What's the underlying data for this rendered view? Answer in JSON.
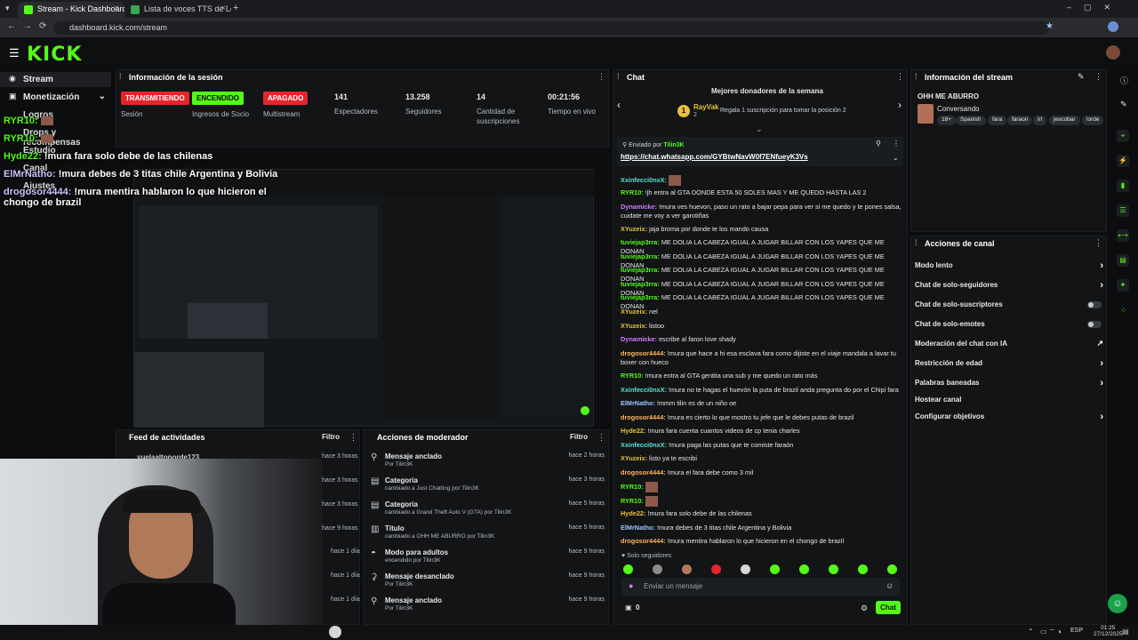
{
  "browser": {
    "tabs": [
      {
        "title": "Stream - Kick Dashboard"
      },
      {
        "title": "Lista de voces TTS de LordEmp"
      }
    ],
    "url": "dashboard.kick.com/stream"
  },
  "brand": {
    "logo": "KICK",
    "accent": "#53fc18"
  },
  "sidebar": {
    "items": [
      {
        "label": "Stream"
      },
      {
        "label": "Monetización"
      },
      {
        "label": "Logros"
      },
      {
        "label": "Drops y recompensas"
      },
      {
        "label": "Estudio"
      },
      {
        "label": "Canal"
      },
      {
        "label": "Ajustes"
      }
    ]
  },
  "overlay_chat": [
    {
      "user": "RYR10:",
      "text": ""
    },
    {
      "user": "RYR10:",
      "text": ""
    },
    {
      "user": "Hyde22:",
      "text": "!mura fara solo debe de las chilenas"
    },
    {
      "user": "ElMrNatho:",
      "text": "!mura debes de 3 titas chile Argentina y Bolivia"
    },
    {
      "user": "drogosor4444:",
      "text": "!mura mentira hablaron lo que hicieron el chongo de brazil"
    }
  ],
  "session": {
    "title": "Información de la sesión",
    "stats": [
      {
        "value": "TRANSMITIENDO",
        "label": "Sesión",
        "color": "#e5252b"
      },
      {
        "value": "ENCENDIDO",
        "label": "Ingresos de Socio",
        "color": "#53fc18"
      },
      {
        "value": "APAGADO",
        "label": "Multistream",
        "color": "#e5252b"
      },
      {
        "value": "141",
        "label": "Espectadores"
      },
      {
        "value": "13.258",
        "label": "Seguidores"
      },
      {
        "value": "14",
        "label": "Cantidad de suscripciones"
      },
      {
        "value": "00:21:56",
        "label": "Tiempo en vivo"
      }
    ]
  },
  "activity_feed": {
    "title": "Feed de actividades",
    "filter": "Filtro",
    "first_user": "yuelaaltoporde123",
    "times": [
      "hace 3 horas",
      "hace 3 horas",
      "hace 3 horas",
      "hace 9 horas",
      "hace 1 día",
      "hace 1 día",
      "hace 1 día"
    ]
  },
  "mod_actions": {
    "title": "Acciones de moderador",
    "filter": "Filtro",
    "items": [
      {
        "title": "Mensaje anclado",
        "sub": "Por Tilin3K",
        "time": "hace 2 horas",
        "icon": "pin-icon"
      },
      {
        "title": "Categoría",
        "sub": "cambiado a Just Chatting por Tilin3K",
        "time": "hace 3 horas",
        "icon": "category-icon"
      },
      {
        "title": "Categoría",
        "sub": "cambiado a Grand Theft Auto V (GTA) por Tilin3K",
        "time": "hace 5 horas",
        "icon": "category-icon"
      },
      {
        "title": "Título",
        "sub": "cambiado a OHH ME ABURRO por Tilin3K",
        "time": "hace 5 horas",
        "icon": "title-icon"
      },
      {
        "title": "Modo para adultos",
        "sub": "encendido por Tilin3K",
        "time": "hace 9 horas",
        "icon": "adult-icon"
      },
      {
        "title": "Mensaje desanclado",
        "sub": "Por Tilin3K",
        "time": "hace 9 horas",
        "icon": "unpin-icon"
      },
      {
        "title": "Mensaje anclado",
        "sub": "Por Tilin3K",
        "time": "hace 9 horas",
        "icon": "pin-icon"
      }
    ]
  },
  "chat": {
    "title": "Chat",
    "donors_title": "Mejores donadores de la semana",
    "top_donor": "RayVak",
    "top_donor_count": "2",
    "donor_prompt": "Regala 1 suscripción para tomar la posición 2",
    "pinned_label": "Enviado por",
    "pinned_user": "Tilin3K",
    "pinned_link": "https://chat.whatsapp.com/GYBtwNavW0f7ENfueyK3Vs",
    "messages": [
      {
        "user": "Xxinfecci0nxX:",
        "text": "",
        "cls": "u-c"
      },
      {
        "user": "RYR10:",
        "text": "!jh entra al GTA DONDE ESTA 50 SOLES MAS Y ME QUEDO HASTA LAS 2",
        "cls": "u-g"
      },
      {
        "user": "Dynamicke:",
        "text": "!mura ves huevon, paso un rato a bajar pepa para ver si me quedo y te pones salsa, cuidate me voy a ver garotiñas",
        "cls": "u-p"
      },
      {
        "user": "XYuzeix:",
        "text": "jaja broma por donde te los mando causa",
        "cls": "u-y"
      },
      {
        "user": "tuviejap3rra:",
        "text": "ME DOLIA LA CABEZA IGUAL A JUGAR BILLAR CON LOS YAPES QUE ME DONAN",
        "cls": "u-g"
      },
      {
        "user": "tuviejap3rra:",
        "text": "ME DOLIA LA CABEZA IGUAL A JUGAR BILLAR CON LOS YAPES QUE ME DONAN",
        "cls": "u-g"
      },
      {
        "user": "tuviejap3rra:",
        "text": "ME DOLIA LA CABEZA IGUAL A JUGAR BILLAR CON LOS YAPES QUE ME DONAN",
        "cls": "u-g"
      },
      {
        "user": "tuviejap3rra:",
        "text": "ME DOLIA LA CABEZA IGUAL A JUGAR BILLAR CON LOS YAPES QUE ME DONAN",
        "cls": "u-g"
      },
      {
        "user": "tuviejap3rra:",
        "text": "ME DOLIA LA CABEZA IGUAL A JUGAR BILLAR CON LOS YAPES QUE ME DONAN",
        "cls": "u-g"
      },
      {
        "user": "XYuzeix:",
        "text": "nel",
        "cls": "u-y"
      },
      {
        "user": "XYuzeix:",
        "text": "listoo",
        "cls": "u-y"
      },
      {
        "user": "Dynamicke:",
        "text": "escribe al faron love shady",
        "cls": "u-p"
      },
      {
        "user": "drogosor4444:",
        "text": "!mura que hace a hi esa esclava fara como dijiste en el viaje mandala a lavar tu boxer con hueco",
        "cls": "u-o"
      },
      {
        "user": "RYR10:",
        "text": "!mura entra al GTA gentita una sub y me quedo un rato más",
        "cls": "u-g"
      },
      {
        "user": "Xxinfecci0nxX:",
        "text": "!mura no te hagas el huevón la puta de brazil anda pregunta do por el Chipi fara",
        "cls": "u-c"
      },
      {
        "user": "ElMrNatho:",
        "text": "!mmm tilin es de un niño oe",
        "cls": "u-b"
      },
      {
        "user": "drogosor4444:",
        "text": "!mura es cierto lo que mostro tu jefe que le debes putas de brazil",
        "cls": "u-o"
      },
      {
        "user": "Hyde22:",
        "text": "!mura fara cuenta cuantos videos de cp tenia charles",
        "cls": "u-y"
      },
      {
        "user": "Xxinfecci0nxX:",
        "text": "!mura paga las putas que te comiste faraón",
        "cls": "u-c"
      },
      {
        "user": "XYuzeix:",
        "text": "listo ya te escribi",
        "cls": "u-y"
      },
      {
        "user": "drogosor4444:",
        "text": "!mura el fara debe como 3 mil",
        "cls": "u-o"
      },
      {
        "user": "RYR10:",
        "text": "",
        "cls": "u-g"
      },
      {
        "user": "RYR10:",
        "text": "",
        "cls": "u-g"
      },
      {
        "user": "Hyde22:",
        "text": "!mura fara solo debe de las chilenas",
        "cls": "u-y"
      },
      {
        "user": "ElMrNatho:",
        "text": "!mura debes de 3 titas chile Argentina y Bolivia",
        "cls": "u-b"
      },
      {
        "user": "drogosor4444:",
        "text": "!mura mentira hablaron lo que hicieron en el chongo de brazil",
        "cls": "u-o"
      }
    ],
    "followers_only": "Solo seguidores",
    "input_placeholder": "Enviar un mensaje",
    "counter": "0",
    "send_label": "Chat"
  },
  "stream_info": {
    "title": "Información del stream",
    "stream_title": "OHH ME ABURRO",
    "category": "Conversando",
    "tags": [
      "18+",
      "Spanish",
      "fara",
      "faraon",
      "irl",
      "jescobar",
      "lorde"
    ]
  },
  "channel_actions": {
    "title": "Acciones de canal",
    "items": [
      {
        "label": "Modo lento",
        "control": "arrow"
      },
      {
        "label": "Chat de solo-seguidores",
        "control": "arrow"
      },
      {
        "label": "Chat de solo-suscriptores",
        "control": "toggle"
      },
      {
        "label": "Chat de solo-emotes",
        "control": "toggle"
      },
      {
        "label": "Moderación del chat con IA",
        "control": "external"
      },
      {
        "label": "Restricción de edad",
        "control": "arrow"
      },
      {
        "label": "Palabras baneadas",
        "control": "arrow"
      },
      {
        "label": "Hostear canal",
        "control": "none"
      },
      {
        "label": "Configurar objetivos",
        "control": "arrow"
      }
    ]
  },
  "taskbar": {
    "lang": "ESP",
    "time": "01:25",
    "date": "27/12/2025"
  }
}
